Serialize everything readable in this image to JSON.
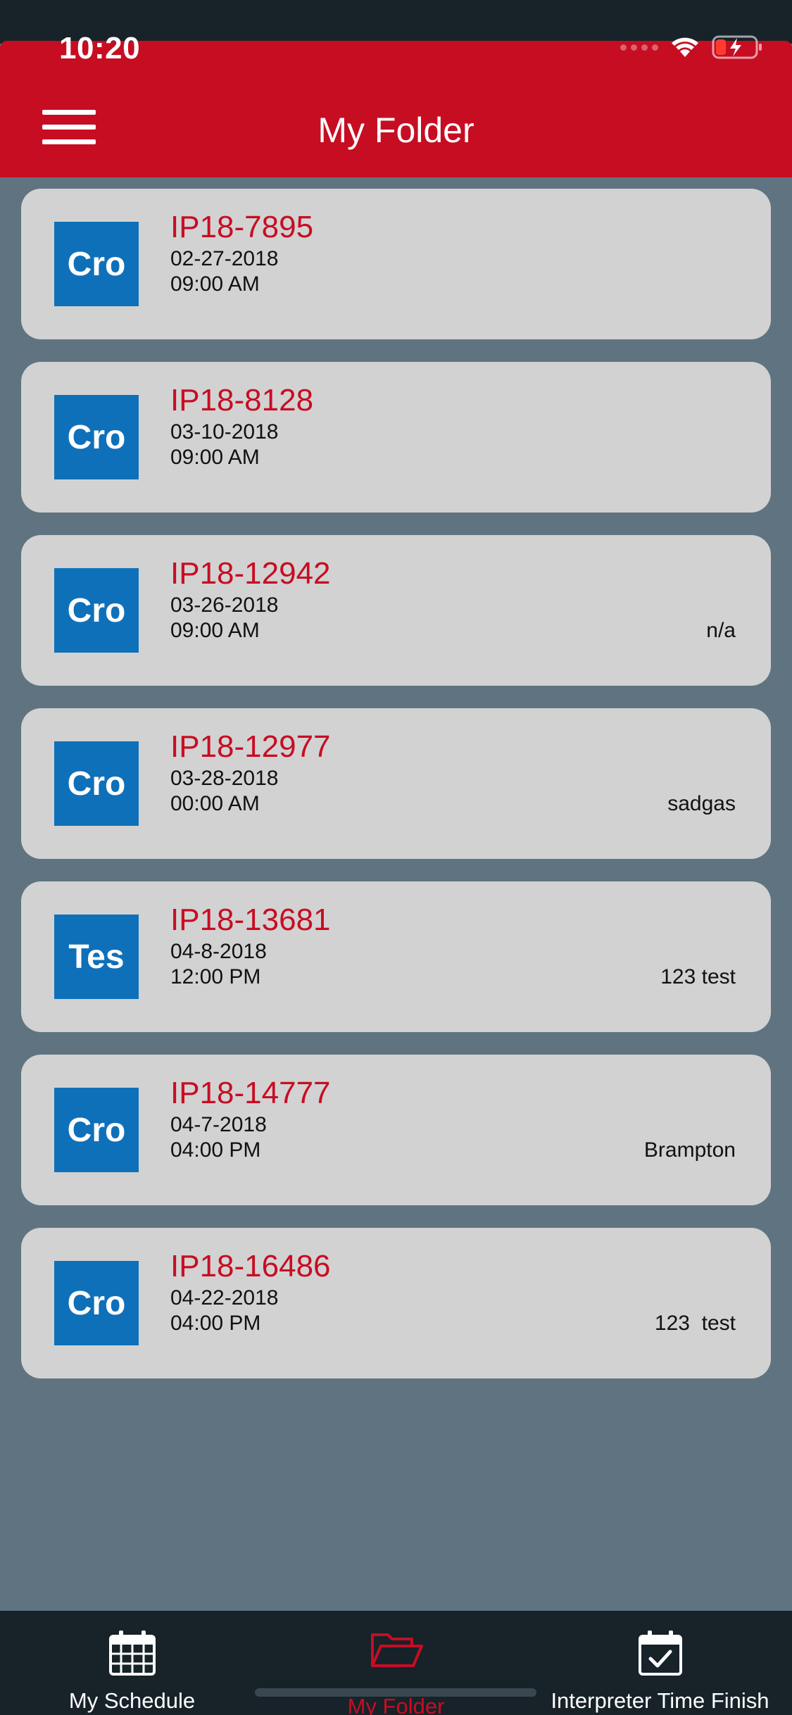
{
  "status_bar": {
    "time": "10:20"
  },
  "header": {
    "title": "My Folder",
    "menu_icon": "hamburger-menu-icon"
  },
  "colors": {
    "header_bg": "#c70d22",
    "background": "#5f7480",
    "card_bg": "#d2d2d2",
    "badge_bg": "#0f70ba",
    "accent_red": "#c70d22",
    "tabbar_bg": "#172229"
  },
  "items": [
    {
      "badge": "Cro",
      "id": "IP18-7895",
      "date": "02-27-2018",
      "time": "09:00 AM",
      "note": ""
    },
    {
      "badge": "Cro",
      "id": "IP18-8128",
      "date": "03-10-2018",
      "time": "09:00 AM",
      "note": ""
    },
    {
      "badge": "Cro",
      "id": "IP18-12942",
      "date": "03-26-2018",
      "time": "09:00 AM",
      "note": "n/a"
    },
    {
      "badge": "Cro",
      "id": "IP18-12977",
      "date": "03-28-2018",
      "time": "00:00 AM",
      "note": "sadgas"
    },
    {
      "badge": "Tes",
      "id": "IP18-13681",
      "date": "04-8-2018",
      "time": "12:00 PM",
      "note": "123 test"
    },
    {
      "badge": "Cro",
      "id": "IP18-14777",
      "date": "04-7-2018",
      "time": "04:00 PM",
      "note": "Brampton"
    },
    {
      "badge": "Cro",
      "id": "IP18-16486",
      "date": "04-22-2018",
      "time": "04:00 PM",
      "note": "123  test"
    }
  ],
  "tabbar": {
    "tabs": [
      {
        "label": "My Schedule",
        "icon": "calendar-icon",
        "active": false
      },
      {
        "label": "My Folder",
        "icon": "folder-open-icon",
        "active": true
      },
      {
        "label": "Interpreter Time Finish",
        "icon": "calendar-check-icon",
        "active": false
      }
    ]
  }
}
